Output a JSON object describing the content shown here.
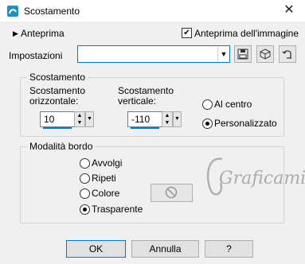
{
  "window": {
    "title": "Scostamento",
    "icon": "app-logo-icon",
    "close": "✕"
  },
  "preview": {
    "label": "Anteprima",
    "checkbox_label": "Anteprima dell'immagine",
    "checked": true
  },
  "presets": {
    "label": "Impostazioni",
    "value": ""
  },
  "offset_group": {
    "title": "Scostamento",
    "horizontal_label_1": "Scostamento",
    "horizontal_label_2": "orizzontale:",
    "horizontal_value": "10",
    "vertical_label_1": "Scostamento",
    "vertical_label_2": "verticale:",
    "vertical_value": "-110",
    "options": [
      {
        "label": "Al centro",
        "selected": false
      },
      {
        "label": "Personalizzato",
        "selected": true
      }
    ]
  },
  "edge_group": {
    "title": "Modalità bordo",
    "options": [
      {
        "label": "Avvolgi",
        "selected": false
      },
      {
        "label": "Ripeti",
        "selected": false
      },
      {
        "label": "Colore",
        "selected": false
      },
      {
        "label": "Trasparente",
        "selected": true
      }
    ]
  },
  "watermark": {
    "text": "Graficamia"
  },
  "buttons": {
    "ok": "OK",
    "cancel": "Annulla",
    "help": "?"
  },
  "colors": {
    "accent": "#0078d7",
    "background": "#f0f0f0"
  }
}
